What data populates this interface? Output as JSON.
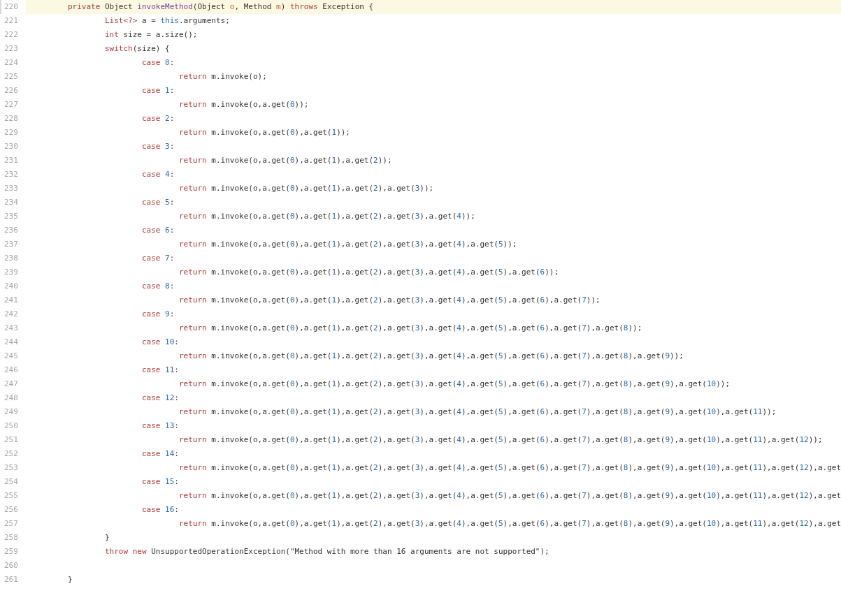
{
  "editor": {
    "lines": [
      {
        "number": "220",
        "selected": true,
        "tokens": [
          {
            "kind": "keyword",
            "text": "\tprivate"
          },
          {
            "kind": "plain",
            "text": " Object "
          },
          {
            "kind": "method",
            "text": "invokeMethod"
          },
          {
            "kind": "plain",
            "text": "(Object "
          },
          {
            "kind": "param",
            "text": "o"
          },
          {
            "kind": "plain",
            "text": ", Method "
          },
          {
            "kind": "param",
            "text": "m"
          },
          {
            "kind": "plain",
            "text": ") "
          },
          {
            "kind": "keyword",
            "text": "throws"
          },
          {
            "kind": "plain",
            "text": " Exception {"
          }
        ]
      },
      {
        "number": "221",
        "selected": false,
        "tokens": [
          {
            "kind": "keyword",
            "text": "\t\tList<?>"
          },
          {
            "kind": "plain",
            "text": " a = "
          },
          {
            "kind": "builtin",
            "text": "this"
          },
          {
            "kind": "plain",
            "text": ".arguments;"
          }
        ]
      },
      {
        "number": "222",
        "selected": false,
        "tokens": [
          {
            "kind": "keyword",
            "text": "\t\tint"
          },
          {
            "kind": "plain",
            "text": " size = a.size();"
          }
        ]
      },
      {
        "number": "223",
        "selected": false,
        "tokens": [
          {
            "kind": "keyword",
            "text": "\t\tswitch"
          },
          {
            "kind": "plain",
            "text": "(size) {"
          }
        ]
      },
      {
        "number": "224",
        "selected": false,
        "tokens": [
          {
            "kind": "keyword",
            "text": "\t\t\tcase "
          },
          {
            "kind": "number",
            "text": "0"
          },
          {
            "kind": "plain",
            "text": ":"
          }
        ]
      },
      {
        "number": "225",
        "selected": false,
        "tokens": [
          {
            "kind": "keyword",
            "text": "\t\t\t\treturn"
          },
          {
            "kind": "plain",
            "text": " m.invoke(o);"
          }
        ]
      },
      {
        "number": "226",
        "selected": false,
        "tokens": [
          {
            "kind": "keyword",
            "text": "\t\t\tcase "
          },
          {
            "kind": "number",
            "text": "1"
          },
          {
            "kind": "plain",
            "text": ":"
          }
        ]
      },
      {
        "number": "227",
        "selected": false,
        "tokens": [
          {
            "kind": "keyword",
            "text": "\t\t\t\treturn"
          },
          {
            "kind": "plain",
            "text": " m.invoke(o,a.get("
          },
          {
            "kind": "number",
            "text": "0"
          },
          {
            "kind": "plain",
            "text": "));"
          }
        ]
      },
      {
        "number": "228",
        "selected": false,
        "tokens": [
          {
            "kind": "keyword",
            "text": "\t\t\tcase "
          },
          {
            "kind": "number",
            "text": "2"
          },
          {
            "kind": "plain",
            "text": ":"
          }
        ]
      },
      {
        "number": "229",
        "selected": false,
        "tokens": [
          {
            "kind": "keyword",
            "text": "\t\t\t\treturn"
          },
          {
            "kind": "plain",
            "text": " m.invoke(o,a.get("
          },
          {
            "kind": "number",
            "text": "0"
          },
          {
            "kind": "plain",
            "text": "),a.get("
          },
          {
            "kind": "number",
            "text": "1"
          },
          {
            "kind": "plain",
            "text": "));"
          }
        ]
      },
      {
        "number": "230",
        "selected": false,
        "tokens": [
          {
            "kind": "keyword",
            "text": "\t\t\tcase "
          },
          {
            "kind": "number",
            "text": "3"
          },
          {
            "kind": "plain",
            "text": ":"
          }
        ]
      },
      {
        "number": "231",
        "selected": false,
        "tokens": [
          {
            "kind": "keyword",
            "text": "\t\t\t\treturn"
          },
          {
            "kind": "plain",
            "text": " m.invoke(o,a.get("
          },
          {
            "kind": "number",
            "text": "0"
          },
          {
            "kind": "plain",
            "text": "),a.get("
          },
          {
            "kind": "number",
            "text": "1"
          },
          {
            "kind": "plain",
            "text": "),a.get("
          },
          {
            "kind": "number",
            "text": "2"
          },
          {
            "kind": "plain",
            "text": "));"
          }
        ]
      },
      {
        "number": "232",
        "selected": false,
        "tokens": [
          {
            "kind": "keyword",
            "text": "\t\t\tcase "
          },
          {
            "kind": "number",
            "text": "4"
          },
          {
            "kind": "plain",
            "text": ":"
          }
        ]
      },
      {
        "number": "233",
        "selected": false,
        "tokens": [
          {
            "kind": "keyword",
            "text": "\t\t\t\treturn"
          },
          {
            "kind": "plain",
            "text": " m.invoke(o,a.get("
          },
          {
            "kind": "number",
            "text": "0"
          },
          {
            "kind": "plain",
            "text": "),a.get("
          },
          {
            "kind": "number",
            "text": "1"
          },
          {
            "kind": "plain",
            "text": "),a.get("
          },
          {
            "kind": "number",
            "text": "2"
          },
          {
            "kind": "plain",
            "text": "),a.get("
          },
          {
            "kind": "number",
            "text": "3"
          },
          {
            "kind": "plain",
            "text": "));"
          }
        ]
      },
      {
        "number": "234",
        "selected": false,
        "tokens": [
          {
            "kind": "keyword",
            "text": "\t\t\tcase "
          },
          {
            "kind": "number",
            "text": "5"
          },
          {
            "kind": "plain",
            "text": ":"
          }
        ]
      },
      {
        "number": "235",
        "selected": false,
        "tokens": [
          {
            "kind": "keyword",
            "text": "\t\t\t\treturn"
          },
          {
            "kind": "plain",
            "text": " m.invoke(o,a.get("
          },
          {
            "kind": "number",
            "text": "0"
          },
          {
            "kind": "plain",
            "text": "),a.get("
          },
          {
            "kind": "number",
            "text": "1"
          },
          {
            "kind": "plain",
            "text": "),a.get("
          },
          {
            "kind": "number",
            "text": "2"
          },
          {
            "kind": "plain",
            "text": "),a.get("
          },
          {
            "kind": "number",
            "text": "3"
          },
          {
            "kind": "plain",
            "text": "),a.get("
          },
          {
            "kind": "number",
            "text": "4"
          },
          {
            "kind": "plain",
            "text": "));"
          }
        ]
      },
      {
        "number": "236",
        "selected": false,
        "tokens": [
          {
            "kind": "keyword",
            "text": "\t\t\tcase "
          },
          {
            "kind": "number",
            "text": "6"
          },
          {
            "kind": "plain",
            "text": ":"
          }
        ]
      },
      {
        "number": "237",
        "selected": false,
        "tokens": [
          {
            "kind": "keyword",
            "text": "\t\t\t\treturn"
          },
          {
            "kind": "plain",
            "text": " m.invoke(o,a.get("
          },
          {
            "kind": "number",
            "text": "0"
          },
          {
            "kind": "plain",
            "text": "),a.get("
          },
          {
            "kind": "number",
            "text": "1"
          },
          {
            "kind": "plain",
            "text": "),a.get("
          },
          {
            "kind": "number",
            "text": "2"
          },
          {
            "kind": "plain",
            "text": "),a.get("
          },
          {
            "kind": "number",
            "text": "3"
          },
          {
            "kind": "plain",
            "text": "),a.get("
          },
          {
            "kind": "number",
            "text": "4"
          },
          {
            "kind": "plain",
            "text": "),a.get("
          },
          {
            "kind": "number",
            "text": "5"
          },
          {
            "kind": "plain",
            "text": "));"
          }
        ]
      },
      {
        "number": "238",
        "selected": false,
        "tokens": [
          {
            "kind": "keyword",
            "text": "\t\t\tcase "
          },
          {
            "kind": "number",
            "text": "7"
          },
          {
            "kind": "plain",
            "text": ":"
          }
        ]
      },
      {
        "number": "239",
        "selected": false,
        "tokens": [
          {
            "kind": "keyword",
            "text": "\t\t\t\treturn"
          },
          {
            "kind": "plain",
            "text": " m.invoke(o,a.get("
          },
          {
            "kind": "number",
            "text": "0"
          },
          {
            "kind": "plain",
            "text": "),a.get("
          },
          {
            "kind": "number",
            "text": "1"
          },
          {
            "kind": "plain",
            "text": "),a.get("
          },
          {
            "kind": "number",
            "text": "2"
          },
          {
            "kind": "plain",
            "text": "),a.get("
          },
          {
            "kind": "number",
            "text": "3"
          },
          {
            "kind": "plain",
            "text": "),a.get("
          },
          {
            "kind": "number",
            "text": "4"
          },
          {
            "kind": "plain",
            "text": "),a.get("
          },
          {
            "kind": "number",
            "text": "5"
          },
          {
            "kind": "plain",
            "text": "),a.get("
          },
          {
            "kind": "number",
            "text": "6"
          },
          {
            "kind": "plain",
            "text": "));"
          }
        ]
      },
      {
        "number": "240",
        "selected": false,
        "tokens": [
          {
            "kind": "keyword",
            "text": "\t\t\tcase "
          },
          {
            "kind": "number",
            "text": "8"
          },
          {
            "kind": "plain",
            "text": ":"
          }
        ]
      },
      {
        "number": "241",
        "selected": false,
        "tokens": [
          {
            "kind": "keyword",
            "text": "\t\t\t\treturn"
          },
          {
            "kind": "plain",
            "text": " m.invoke(o,a.get("
          },
          {
            "kind": "number",
            "text": "0"
          },
          {
            "kind": "plain",
            "text": "),a.get("
          },
          {
            "kind": "number",
            "text": "1"
          },
          {
            "kind": "plain",
            "text": "),a.get("
          },
          {
            "kind": "number",
            "text": "2"
          },
          {
            "kind": "plain",
            "text": "),a.get("
          },
          {
            "kind": "number",
            "text": "3"
          },
          {
            "kind": "plain",
            "text": "),a.get("
          },
          {
            "kind": "number",
            "text": "4"
          },
          {
            "kind": "plain",
            "text": "),a.get("
          },
          {
            "kind": "number",
            "text": "5"
          },
          {
            "kind": "plain",
            "text": "),a.get("
          },
          {
            "kind": "number",
            "text": "6"
          },
          {
            "kind": "plain",
            "text": "),a.get("
          },
          {
            "kind": "number",
            "text": "7"
          },
          {
            "kind": "plain",
            "text": "));"
          }
        ]
      },
      {
        "number": "242",
        "selected": false,
        "tokens": [
          {
            "kind": "keyword",
            "text": "\t\t\tcase "
          },
          {
            "kind": "number",
            "text": "9"
          },
          {
            "kind": "plain",
            "text": ":"
          }
        ]
      },
      {
        "number": "243",
        "selected": false,
        "tokens": [
          {
            "kind": "keyword",
            "text": "\t\t\t\treturn"
          },
          {
            "kind": "plain",
            "text": " m.invoke(o,a.get("
          },
          {
            "kind": "number",
            "text": "0"
          },
          {
            "kind": "plain",
            "text": "),a.get("
          },
          {
            "kind": "number",
            "text": "1"
          },
          {
            "kind": "plain",
            "text": "),a.get("
          },
          {
            "kind": "number",
            "text": "2"
          },
          {
            "kind": "plain",
            "text": "),a.get("
          },
          {
            "kind": "number",
            "text": "3"
          },
          {
            "kind": "plain",
            "text": "),a.get("
          },
          {
            "kind": "number",
            "text": "4"
          },
          {
            "kind": "plain",
            "text": "),a.get("
          },
          {
            "kind": "number",
            "text": "5"
          },
          {
            "kind": "plain",
            "text": "),a.get("
          },
          {
            "kind": "number",
            "text": "6"
          },
          {
            "kind": "plain",
            "text": "),a.get("
          },
          {
            "kind": "number",
            "text": "7"
          },
          {
            "kind": "plain",
            "text": "),a.get("
          },
          {
            "kind": "number",
            "text": "8"
          },
          {
            "kind": "plain",
            "text": "));"
          }
        ]
      },
      {
        "number": "244",
        "selected": false,
        "tokens": [
          {
            "kind": "keyword",
            "text": "\t\t\tcase "
          },
          {
            "kind": "number",
            "text": "10"
          },
          {
            "kind": "plain",
            "text": ":"
          }
        ]
      },
      {
        "number": "245",
        "selected": false,
        "tokens": [
          {
            "kind": "keyword",
            "text": "\t\t\t\treturn"
          },
          {
            "kind": "plain",
            "text": " m.invoke(o,a.get("
          },
          {
            "kind": "number",
            "text": "0"
          },
          {
            "kind": "plain",
            "text": "),a.get("
          },
          {
            "kind": "number",
            "text": "1"
          },
          {
            "kind": "plain",
            "text": "),a.get("
          },
          {
            "kind": "number",
            "text": "2"
          },
          {
            "kind": "plain",
            "text": "),a.get("
          },
          {
            "kind": "number",
            "text": "3"
          },
          {
            "kind": "plain",
            "text": "),a.get("
          },
          {
            "kind": "number",
            "text": "4"
          },
          {
            "kind": "plain",
            "text": "),a.get("
          },
          {
            "kind": "number",
            "text": "5"
          },
          {
            "kind": "plain",
            "text": "),a.get("
          },
          {
            "kind": "number",
            "text": "6"
          },
          {
            "kind": "plain",
            "text": "),a.get("
          },
          {
            "kind": "number",
            "text": "7"
          },
          {
            "kind": "plain",
            "text": "),a.get("
          },
          {
            "kind": "number",
            "text": "8"
          },
          {
            "kind": "plain",
            "text": "),a.get("
          },
          {
            "kind": "number",
            "text": "9"
          },
          {
            "kind": "plain",
            "text": "));"
          }
        ]
      },
      {
        "number": "246",
        "selected": false,
        "tokens": [
          {
            "kind": "keyword",
            "text": "\t\t\tcase "
          },
          {
            "kind": "number",
            "text": "11"
          },
          {
            "kind": "plain",
            "text": ":"
          }
        ]
      },
      {
        "number": "247",
        "selected": false,
        "tokens": [
          {
            "kind": "keyword",
            "text": "\t\t\t\treturn"
          },
          {
            "kind": "plain",
            "text": " m.invoke(o,a.get("
          },
          {
            "kind": "number",
            "text": "0"
          },
          {
            "kind": "plain",
            "text": "),a.get("
          },
          {
            "kind": "number",
            "text": "1"
          },
          {
            "kind": "plain",
            "text": "),a.get("
          },
          {
            "kind": "number",
            "text": "2"
          },
          {
            "kind": "plain",
            "text": "),a.get("
          },
          {
            "kind": "number",
            "text": "3"
          },
          {
            "kind": "plain",
            "text": "),a.get("
          },
          {
            "kind": "number",
            "text": "4"
          },
          {
            "kind": "plain",
            "text": "),a.get("
          },
          {
            "kind": "number",
            "text": "5"
          },
          {
            "kind": "plain",
            "text": "),a.get("
          },
          {
            "kind": "number",
            "text": "6"
          },
          {
            "kind": "plain",
            "text": "),a.get("
          },
          {
            "kind": "number",
            "text": "7"
          },
          {
            "kind": "plain",
            "text": "),a.get("
          },
          {
            "kind": "number",
            "text": "8"
          },
          {
            "kind": "plain",
            "text": "),a.get("
          },
          {
            "kind": "number",
            "text": "9"
          },
          {
            "kind": "plain",
            "text": "),a.get("
          },
          {
            "kind": "number",
            "text": "10"
          },
          {
            "kind": "plain",
            "text": "));"
          }
        ]
      },
      {
        "number": "248",
        "selected": false,
        "tokens": [
          {
            "kind": "keyword",
            "text": "\t\t\tcase "
          },
          {
            "kind": "number",
            "text": "12"
          },
          {
            "kind": "plain",
            "text": ":"
          }
        ]
      },
      {
        "number": "249",
        "selected": false,
        "tokens": [
          {
            "kind": "keyword",
            "text": "\t\t\t\treturn"
          },
          {
            "kind": "plain",
            "text": " m.invoke(o,a.get("
          },
          {
            "kind": "number",
            "text": "0"
          },
          {
            "kind": "plain",
            "text": "),a.get("
          },
          {
            "kind": "number",
            "text": "1"
          },
          {
            "kind": "plain",
            "text": "),a.get("
          },
          {
            "kind": "number",
            "text": "2"
          },
          {
            "kind": "plain",
            "text": "),a.get("
          },
          {
            "kind": "number",
            "text": "3"
          },
          {
            "kind": "plain",
            "text": "),a.get("
          },
          {
            "kind": "number",
            "text": "4"
          },
          {
            "kind": "plain",
            "text": "),a.get("
          },
          {
            "kind": "number",
            "text": "5"
          },
          {
            "kind": "plain",
            "text": "),a.get("
          },
          {
            "kind": "number",
            "text": "6"
          },
          {
            "kind": "plain",
            "text": "),a.get("
          },
          {
            "kind": "number",
            "text": "7"
          },
          {
            "kind": "plain",
            "text": "),a.get("
          },
          {
            "kind": "number",
            "text": "8"
          },
          {
            "kind": "plain",
            "text": "),a.get("
          },
          {
            "kind": "number",
            "text": "9"
          },
          {
            "kind": "plain",
            "text": "),a.get("
          },
          {
            "kind": "number",
            "text": "10"
          },
          {
            "kind": "plain",
            "text": "),a.get("
          },
          {
            "kind": "number",
            "text": "11"
          },
          {
            "kind": "plain",
            "text": "));"
          }
        ]
      },
      {
        "number": "250",
        "selected": false,
        "tokens": [
          {
            "kind": "keyword",
            "text": "\t\t\tcase "
          },
          {
            "kind": "number",
            "text": "13"
          },
          {
            "kind": "plain",
            "text": ":"
          }
        ]
      },
      {
        "number": "251",
        "selected": false,
        "tokens": [
          {
            "kind": "keyword",
            "text": "\t\t\t\treturn"
          },
          {
            "kind": "plain",
            "text": " m.invoke(o,a.get("
          },
          {
            "kind": "number",
            "text": "0"
          },
          {
            "kind": "plain",
            "text": "),a.get("
          },
          {
            "kind": "number",
            "text": "1"
          },
          {
            "kind": "plain",
            "text": "),a.get("
          },
          {
            "kind": "number",
            "text": "2"
          },
          {
            "kind": "plain",
            "text": "),a.get("
          },
          {
            "kind": "number",
            "text": "3"
          },
          {
            "kind": "plain",
            "text": "),a.get("
          },
          {
            "kind": "number",
            "text": "4"
          },
          {
            "kind": "plain",
            "text": "),a.get("
          },
          {
            "kind": "number",
            "text": "5"
          },
          {
            "kind": "plain",
            "text": "),a.get("
          },
          {
            "kind": "number",
            "text": "6"
          },
          {
            "kind": "plain",
            "text": "),a.get("
          },
          {
            "kind": "number",
            "text": "7"
          },
          {
            "kind": "plain",
            "text": "),a.get("
          },
          {
            "kind": "number",
            "text": "8"
          },
          {
            "kind": "plain",
            "text": "),a.get("
          },
          {
            "kind": "number",
            "text": "9"
          },
          {
            "kind": "plain",
            "text": "),a.get("
          },
          {
            "kind": "number",
            "text": "10"
          },
          {
            "kind": "plain",
            "text": "),a.get("
          },
          {
            "kind": "number",
            "text": "11"
          },
          {
            "kind": "plain",
            "text": "),a.get("
          },
          {
            "kind": "number",
            "text": "12"
          },
          {
            "kind": "plain",
            "text": "));"
          }
        ]
      },
      {
        "number": "252",
        "selected": false,
        "tokens": [
          {
            "kind": "keyword",
            "text": "\t\t\tcase "
          },
          {
            "kind": "number",
            "text": "14"
          },
          {
            "kind": "plain",
            "text": ":"
          }
        ]
      },
      {
        "number": "253",
        "selected": false,
        "tokens": [
          {
            "kind": "keyword",
            "text": "\t\t\t\treturn"
          },
          {
            "kind": "plain",
            "text": " m.invoke(o,a.get("
          },
          {
            "kind": "number",
            "text": "0"
          },
          {
            "kind": "plain",
            "text": "),a.get("
          },
          {
            "kind": "number",
            "text": "1"
          },
          {
            "kind": "plain",
            "text": "),a.get("
          },
          {
            "kind": "number",
            "text": "2"
          },
          {
            "kind": "plain",
            "text": "),a.get("
          },
          {
            "kind": "number",
            "text": "3"
          },
          {
            "kind": "plain",
            "text": "),a.get("
          },
          {
            "kind": "number",
            "text": "4"
          },
          {
            "kind": "plain",
            "text": "),a.get("
          },
          {
            "kind": "number",
            "text": "5"
          },
          {
            "kind": "plain",
            "text": "),a.get("
          },
          {
            "kind": "number",
            "text": "6"
          },
          {
            "kind": "plain",
            "text": "),a.get("
          },
          {
            "kind": "number",
            "text": "7"
          },
          {
            "kind": "plain",
            "text": "),a.get("
          },
          {
            "kind": "number",
            "text": "8"
          },
          {
            "kind": "plain",
            "text": "),a.get("
          },
          {
            "kind": "number",
            "text": "9"
          },
          {
            "kind": "plain",
            "text": "),a.get("
          },
          {
            "kind": "number",
            "text": "10"
          },
          {
            "kind": "plain",
            "text": "),a.get("
          },
          {
            "kind": "number",
            "text": "11"
          },
          {
            "kind": "plain",
            "text": "),a.get("
          },
          {
            "kind": "number",
            "text": "12"
          },
          {
            "kind": "plain",
            "text": "),a.get"
          }
        ]
      },
      {
        "number": "254",
        "selected": false,
        "tokens": [
          {
            "kind": "keyword",
            "text": "\t\t\tcase "
          },
          {
            "kind": "number",
            "text": "15"
          },
          {
            "kind": "plain",
            "text": ":"
          }
        ]
      },
      {
        "number": "255",
        "selected": false,
        "tokens": [
          {
            "kind": "keyword",
            "text": "\t\t\t\treturn"
          },
          {
            "kind": "plain",
            "text": " m.invoke(o,a.get("
          },
          {
            "kind": "number",
            "text": "0"
          },
          {
            "kind": "plain",
            "text": "),a.get("
          },
          {
            "kind": "number",
            "text": "1"
          },
          {
            "kind": "plain",
            "text": "),a.get("
          },
          {
            "kind": "number",
            "text": "2"
          },
          {
            "kind": "plain",
            "text": "),a.get("
          },
          {
            "kind": "number",
            "text": "3"
          },
          {
            "kind": "plain",
            "text": "),a.get("
          },
          {
            "kind": "number",
            "text": "4"
          },
          {
            "kind": "plain",
            "text": "),a.get("
          },
          {
            "kind": "number",
            "text": "5"
          },
          {
            "kind": "plain",
            "text": "),a.get("
          },
          {
            "kind": "number",
            "text": "6"
          },
          {
            "kind": "plain",
            "text": "),a.get("
          },
          {
            "kind": "number",
            "text": "7"
          },
          {
            "kind": "plain",
            "text": "),a.get("
          },
          {
            "kind": "number",
            "text": "8"
          },
          {
            "kind": "plain",
            "text": "),a.get("
          },
          {
            "kind": "number",
            "text": "9"
          },
          {
            "kind": "plain",
            "text": "),a.get("
          },
          {
            "kind": "number",
            "text": "10"
          },
          {
            "kind": "plain",
            "text": "),a.get("
          },
          {
            "kind": "number",
            "text": "11"
          },
          {
            "kind": "plain",
            "text": "),a.get("
          },
          {
            "kind": "number",
            "text": "12"
          },
          {
            "kind": "plain",
            "text": "),a.get"
          }
        ]
      },
      {
        "number": "256",
        "selected": false,
        "tokens": [
          {
            "kind": "keyword",
            "text": "\t\t\tcase "
          },
          {
            "kind": "number",
            "text": "16"
          },
          {
            "kind": "plain",
            "text": ":"
          }
        ]
      },
      {
        "number": "257",
        "selected": false,
        "tokens": [
          {
            "kind": "keyword",
            "text": "\t\t\t\treturn"
          },
          {
            "kind": "plain",
            "text": " m.invoke(o,a.get("
          },
          {
            "kind": "number",
            "text": "0"
          },
          {
            "kind": "plain",
            "text": "),a.get("
          },
          {
            "kind": "number",
            "text": "1"
          },
          {
            "kind": "plain",
            "text": "),a.get("
          },
          {
            "kind": "number",
            "text": "2"
          },
          {
            "kind": "plain",
            "text": "),a.get("
          },
          {
            "kind": "number",
            "text": "3"
          },
          {
            "kind": "plain",
            "text": "),a.get("
          },
          {
            "kind": "number",
            "text": "4"
          },
          {
            "kind": "plain",
            "text": "),a.get("
          },
          {
            "kind": "number",
            "text": "5"
          },
          {
            "kind": "plain",
            "text": "),a.get("
          },
          {
            "kind": "number",
            "text": "6"
          },
          {
            "kind": "plain",
            "text": "),a.get("
          },
          {
            "kind": "number",
            "text": "7"
          },
          {
            "kind": "plain",
            "text": "),a.get("
          },
          {
            "kind": "number",
            "text": "8"
          },
          {
            "kind": "plain",
            "text": "),a.get("
          },
          {
            "kind": "number",
            "text": "9"
          },
          {
            "kind": "plain",
            "text": "),a.get("
          },
          {
            "kind": "number",
            "text": "10"
          },
          {
            "kind": "plain",
            "text": "),a.get("
          },
          {
            "kind": "number",
            "text": "11"
          },
          {
            "kind": "plain",
            "text": "),a.get("
          },
          {
            "kind": "number",
            "text": "12"
          },
          {
            "kind": "plain",
            "text": "),a.get"
          }
        ]
      },
      {
        "number": "258",
        "selected": false,
        "tokens": [
          {
            "kind": "plain",
            "text": "\t\t}"
          }
        ]
      },
      {
        "number": "259",
        "selected": false,
        "tokens": [
          {
            "kind": "keyword",
            "text": "\t\tthrow new"
          },
          {
            "kind": "plain",
            "text": " UnsupportedOperationException(\"Method with more than 16 arguments are not supported\");"
          }
        ]
      },
      {
        "number": "260",
        "selected": false
      },
      {
        "number": "261",
        "selected": false,
        "tokens": [
          {
            "kind": "plain",
            "text": "\t}"
          }
        ]
      }
    ]
  }
}
